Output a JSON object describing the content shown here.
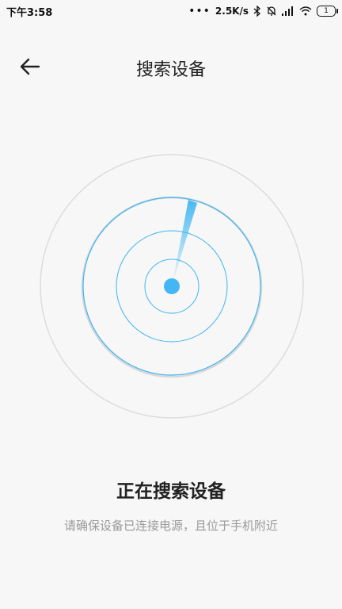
{
  "status_bar": {
    "time": "下午3:58",
    "dots": "•••",
    "network_speed": "2.5K/s",
    "icons": [
      "bluetooth-icon",
      "alarm-off-icon",
      "signal-icon",
      "wifi-icon",
      "battery-icon"
    ],
    "battery_level": "1"
  },
  "header": {
    "back_icon": "arrow-left-icon",
    "title": "搜索设备"
  },
  "radar": {
    "accent_color": "#3fb5f2",
    "outer_ring_color": "#d9d9d9"
  },
  "main": {
    "headline": "正在搜索设备",
    "hint": "请确保设备已连接电源，且位于手机附近"
  }
}
